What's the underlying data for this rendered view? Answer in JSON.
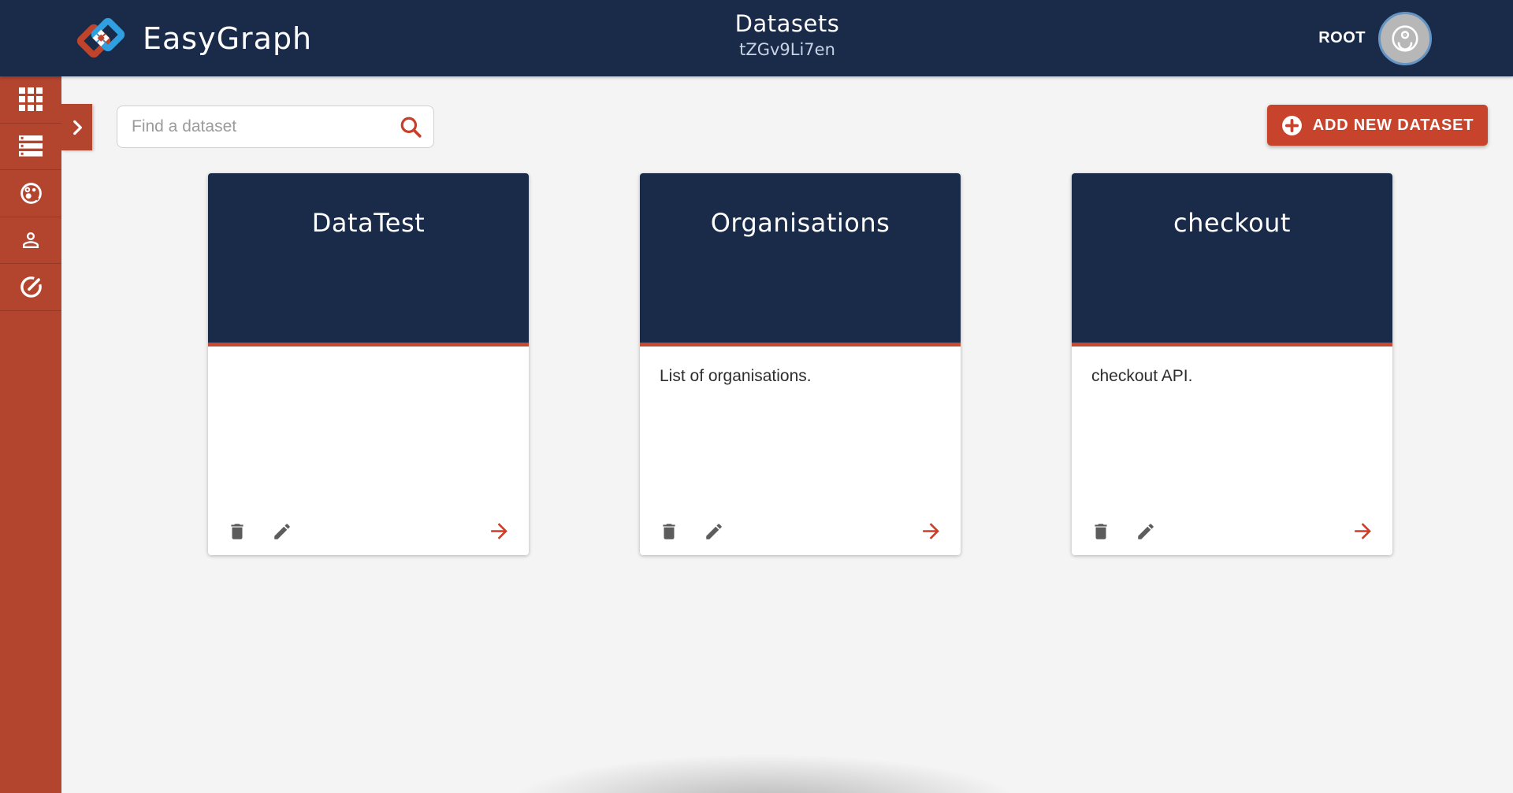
{
  "app": {
    "brand": "EasyGraph"
  },
  "header": {
    "title": "Datasets",
    "subtitle": "tZGv9Li7en",
    "user_label": "ROOT",
    "avatar_icon": "account-circle-icon"
  },
  "sidebar": {
    "icons": [
      "grid-icon",
      "list-icon",
      "palette-icon",
      "person-icon",
      "gauge-icon"
    ],
    "expand_icon": "chevron-right-icon"
  },
  "toolbar": {
    "search_placeholder": "Find a dataset",
    "search_icon": "search-icon",
    "add_button_label": "ADD NEW DATASET",
    "add_button_icon": "plus-circle-icon"
  },
  "cards": [
    {
      "title": "DataTest",
      "description": ""
    },
    {
      "title": "Organisations",
      "description": "List of organisations."
    },
    {
      "title": "checkout",
      "description": "checkout API."
    }
  ],
  "card_action_icons": [
    "trash-icon",
    "pencil-icon",
    "arrow-right-icon"
  ],
  "colors": {
    "navy": "#1a2b49",
    "sidebar_red": "#b3442e",
    "accent_red": "#c8432c",
    "card_underline_red": "#c64a2f",
    "arrow_red": "#d13c28",
    "logo_blue": "#2f9fe0",
    "background": "#f4f4f4",
    "avatar_ring_blue": "#6495c4"
  }
}
